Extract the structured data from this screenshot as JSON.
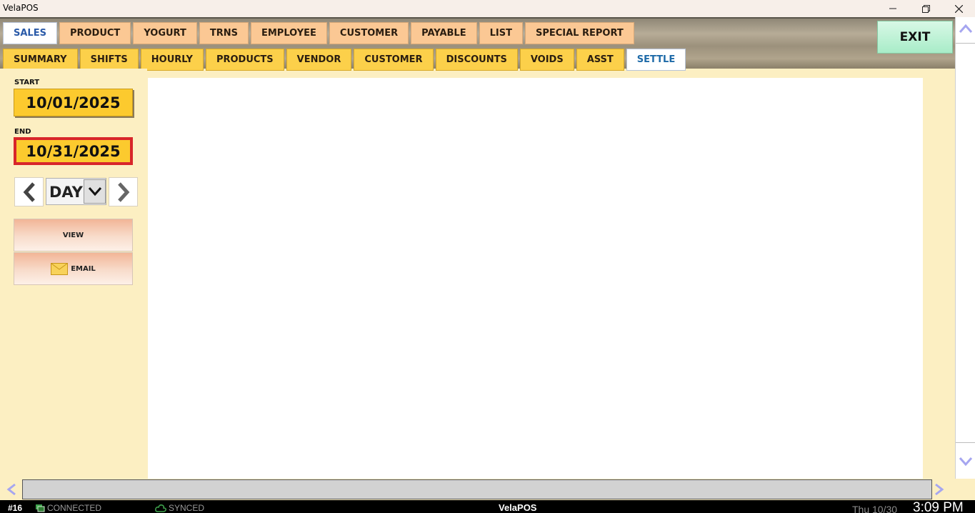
{
  "window": {
    "title": "VelaPOS"
  },
  "tabs_primary": [
    {
      "label": "SALES",
      "active": true
    },
    {
      "label": "PRODUCT",
      "active": false
    },
    {
      "label": "YOGURT",
      "active": false
    },
    {
      "label": "TRNS",
      "active": false
    },
    {
      "label": "EMPLOYEE",
      "active": false
    },
    {
      "label": "CUSTOMER",
      "active": false
    },
    {
      "label": "PAYABLE",
      "active": false
    },
    {
      "label": "LIST",
      "active": false
    },
    {
      "label": "SPECIAL REPORT",
      "active": false
    }
  ],
  "tabs_secondary": [
    {
      "label": "SUMMARY",
      "active": false
    },
    {
      "label": "SHIFTS",
      "active": false
    },
    {
      "label": "HOURLY",
      "active": false
    },
    {
      "label": "PRODUCTS",
      "active": false
    },
    {
      "label": "VENDOR",
      "active": false
    },
    {
      "label": "CUSTOMER",
      "active": false
    },
    {
      "label": "DISCOUNTS",
      "active": false
    },
    {
      "label": "VOIDS",
      "active": false
    },
    {
      "label": "ASST",
      "active": false
    },
    {
      "label": "SETTLE",
      "active": true
    }
  ],
  "exit_label": "EXIT",
  "filters": {
    "start_label": "START",
    "start_date": "10/01/2025",
    "end_label": "END",
    "end_date": "10/31/2025",
    "period_value": "DAY"
  },
  "actions": {
    "view_label": "VIEW",
    "email_label": "EMAIL"
  },
  "status": {
    "terminal": "#16",
    "connection": "CONNECTED",
    "sync": "SYNCED",
    "brand": "VelaPOS",
    "date": "Thu 10/30",
    "time": "3:09 PM"
  },
  "colors": {
    "panel_bg": "#fcefc2",
    "primary_tab": "#fbc894",
    "secondary_tab": "#fcd04a",
    "date_box": "#fcca2e",
    "end_border": "#d8262a",
    "exit_bg": "#a8ecc8",
    "scroll_arrow": "#a6a6f0"
  },
  "icons": [
    "minimize-icon",
    "maximize-icon",
    "close-icon",
    "chevron-left-icon",
    "chevron-right-icon",
    "chevron-down-icon",
    "envelope-icon",
    "scroll-up-icon",
    "scroll-down-icon",
    "scroll-left-icon",
    "scroll-right-icon",
    "network-icon",
    "cloud-icon"
  ]
}
